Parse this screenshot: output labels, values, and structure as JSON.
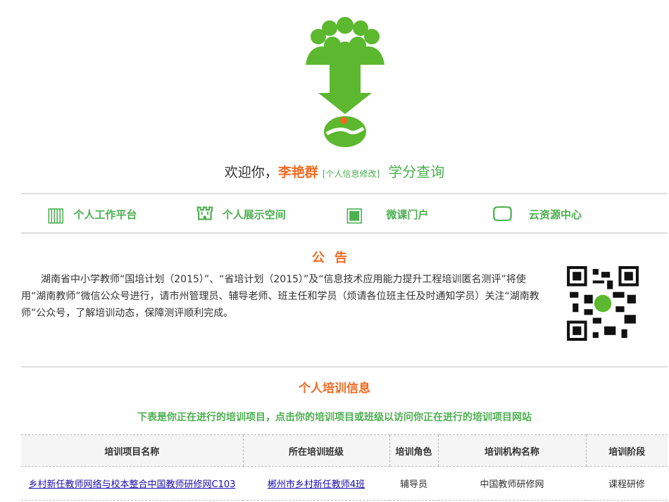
{
  "welcome": {
    "greeting": "欢迎你，",
    "name": "李艳群",
    "edit_link": "[个人信息修改]",
    "credit_link": "学分查询"
  },
  "nav": [
    {
      "label": "个人工作平台"
    },
    {
      "label": "个人展示空间"
    },
    {
      "label": "微课门户"
    },
    {
      "label": "云资源中心"
    }
  ],
  "notice": {
    "title": "公告",
    "body": "湖南省中小学教师“国培计划（2015）”、“省培计划（2015）”及“信息技术应用能力提升工程培训匿名测评”将使用“湖南教师”微信公众号进行，请市州管理员、辅导老师、班主任和学员（烦请各位班主任及时通知学员）关注“湖南教师”公众号，了解培训动态，保障测评顺利完成。"
  },
  "training": {
    "title": "个人培训信息",
    "subtitle": "下表是你正在进行的培训项目，点击你的培训项目或班级以访问你正在进行的培训项目网站",
    "headers": [
      "培训项目名称",
      "所在培训班级",
      "培训角色",
      "培训机构名称",
      "培训阶段"
    ],
    "rows": [
      [
        "乡村新任教师网络与校本整合中国教师研修网C103",
        "郴州市乡村新任教师4班",
        "辅导员",
        "中国教师研修网",
        "课程研修"
      ]
    ]
  },
  "colors": {
    "green": "#4caf50",
    "orange": "#f26b22"
  }
}
